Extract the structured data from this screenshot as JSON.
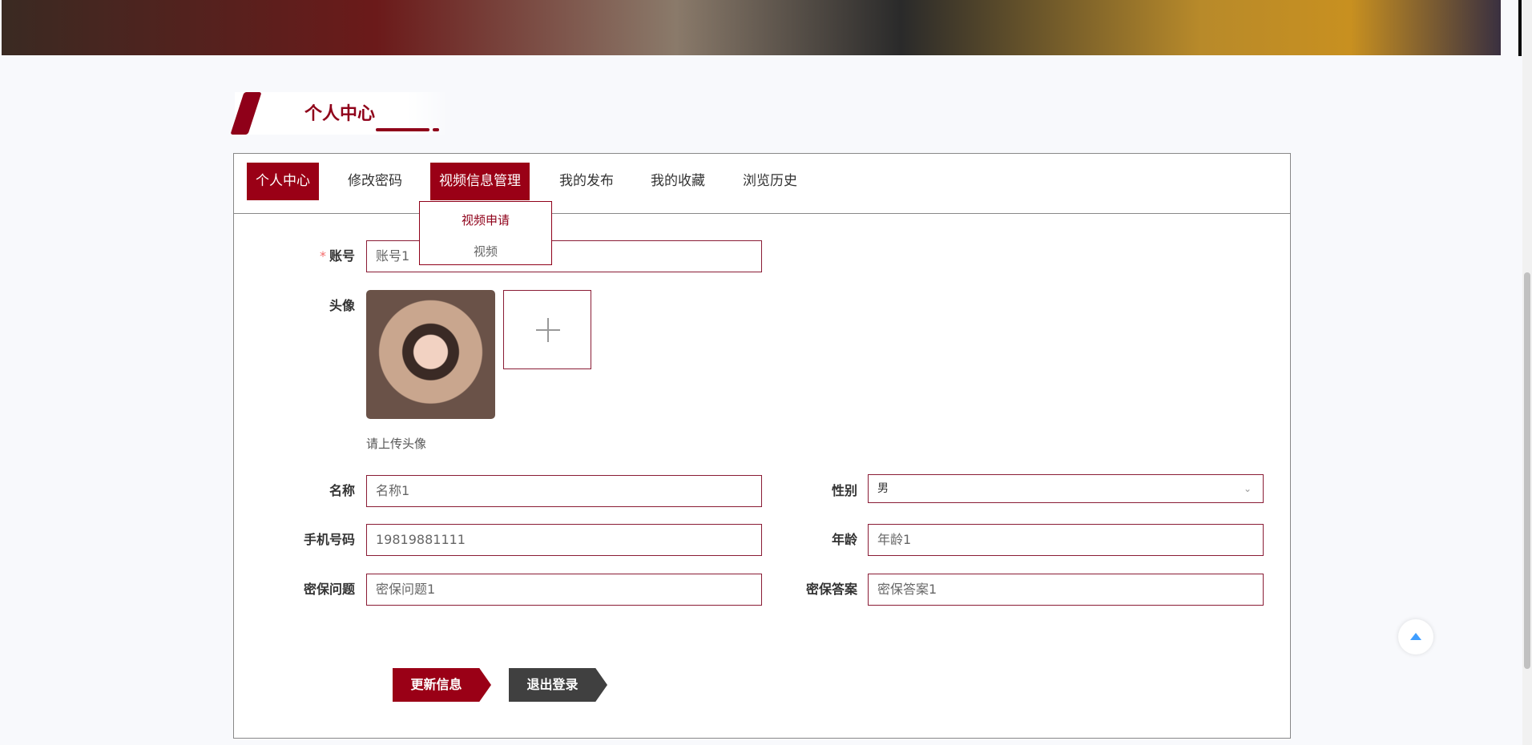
{
  "section_title": "个人中心",
  "tabs": [
    {
      "label": "个人中心",
      "active": true
    },
    {
      "label": "修改密码"
    },
    {
      "label": "视频信息管理",
      "active": true
    },
    {
      "label": "我的发布"
    },
    {
      "label": "我的收藏"
    },
    {
      "label": "浏览历史"
    }
  ],
  "dropdown": {
    "items": [
      "视频申请",
      "视频"
    ]
  },
  "form": {
    "account": {
      "label": "账号",
      "required_mark": "*",
      "value": "账号1"
    },
    "avatar": {
      "label": "头像",
      "hint": "请上传头像"
    },
    "name": {
      "label": "名称",
      "value": "名称1"
    },
    "gender": {
      "label": "性别",
      "value": "男"
    },
    "phone": {
      "label": "手机号码",
      "value": "19819881111"
    },
    "age": {
      "label": "年龄",
      "value": "年龄1"
    },
    "question": {
      "label": "密保问题",
      "value": "密保问题1"
    },
    "answer": {
      "label": "密保答案",
      "value": "密保答案1"
    }
  },
  "buttons": {
    "update": "更新信息",
    "logout": "退出登录"
  },
  "colors": {
    "primary": "#9a0016",
    "dark": "#404040"
  }
}
